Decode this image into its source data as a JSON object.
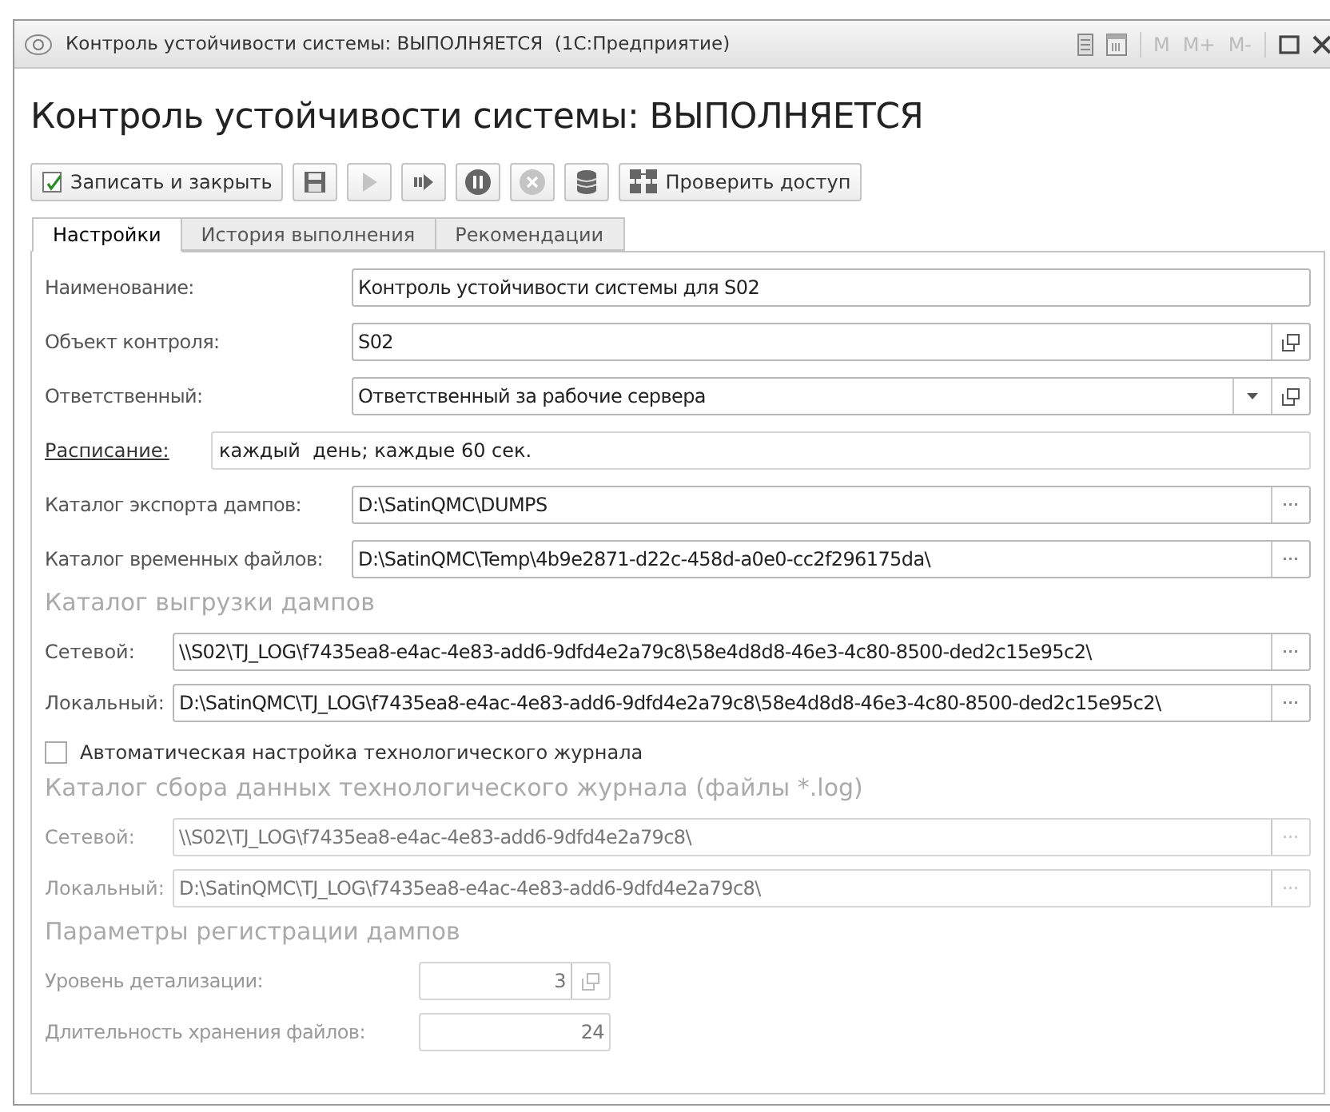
{
  "window": {
    "title": "Контроль устойчивости системы: ВЫПОЛНЯЕТСЯ  (1С:Предприятие)",
    "memory_buttons": [
      {
        "label": "M",
        "disabled": true
      },
      {
        "label": "M+",
        "disabled": true
      },
      {
        "label": "M-",
        "disabled": true
      }
    ]
  },
  "heading": "Контроль устойчивости системы: ВЫПОЛНЯЕТСЯ",
  "toolbar": [
    {
      "kind": "write-close",
      "label": "Записать и закрыть",
      "disabled": false
    },
    {
      "kind": "save",
      "disabled": false
    },
    {
      "kind": "run",
      "disabled": true
    },
    {
      "kind": "step",
      "disabled": false
    },
    {
      "kind": "pause",
      "disabled": false
    },
    {
      "kind": "stop",
      "disabled": true
    },
    {
      "kind": "database",
      "disabled": false
    },
    {
      "kind": "check-access",
      "label": "Проверить доступ",
      "disabled": false
    }
  ],
  "tabs": [
    {
      "label": "Настройки",
      "selected": true
    },
    {
      "label": "История выполнения",
      "selected": false
    },
    {
      "label": "Рекомендации",
      "selected": false
    }
  ],
  "fields": [
    {
      "kind": "text",
      "label": "Наименование:",
      "value": "Контроль устойчивости системы для S02"
    },
    {
      "kind": "ref",
      "label": "Объект контроля:",
      "value": "S02"
    },
    {
      "kind": "select",
      "label": "Ответственный:",
      "value": "Ответственный за рабочие сервера"
    },
    {
      "kind": "link",
      "label": "Расписание:",
      "value": "каждый  день; каждые 60 сек."
    },
    {
      "kind": "path",
      "label": "Каталог экспорта дампов:",
      "value": "D:\\SatinQMC\\DUMPS"
    },
    {
      "kind": "path",
      "label": "Каталог временных файлов:",
      "value": "D:\\SatinQMC\\Temp\\4b9e2871-d22c-458d-a0e0-cc2f296175da\\"
    }
  ],
  "dump_upload": {
    "title": "Каталог выгрузки дампов",
    "disabled": false,
    "fields": [
      {
        "label": "Сетевой:",
        "value": "\\\\S02\\TJ_LOG\\f7435ea8-e4ac-4e83-add6-9dfd4e2a79c8\\58e4d8d8-46e3-4c80-8500-ded2c15e95c2\\"
      },
      {
        "label": "Локальный:",
        "value": "D:\\SatinQMC\\TJ_LOG\\f7435ea8-e4ac-4e83-add6-9dfd4e2a79c8\\58e4d8d8-46e3-4c80-8500-ded2c15e95c2\\"
      }
    ]
  },
  "auto_config": {
    "label": "Автоматическая настройка технологического журнала",
    "checked": false
  },
  "tech_log": {
    "title": "Каталог сбора данных технологического журнала (файлы *.log)",
    "disabled": true,
    "fields": [
      {
        "label": "Сетевой:",
        "value": "\\\\S02\\TJ_LOG\\f7435ea8-e4ac-4e83-add6-9dfd4e2a79c8\\"
      },
      {
        "label": "Локальный:",
        "value": "D:\\SatinQMC\\TJ_LOG\\f7435ea8-e4ac-4e83-add6-9dfd4e2a79c8\\"
      }
    ]
  },
  "dump_params": {
    "title": "Параметры регистрации дампов",
    "disabled": true,
    "fields": [
      {
        "kind": "ref",
        "label": "Уровень детализации:",
        "value": "3"
      },
      {
        "kind": "number",
        "label": "Длительность хранения файлов:",
        "value": "24"
      }
    ]
  }
}
